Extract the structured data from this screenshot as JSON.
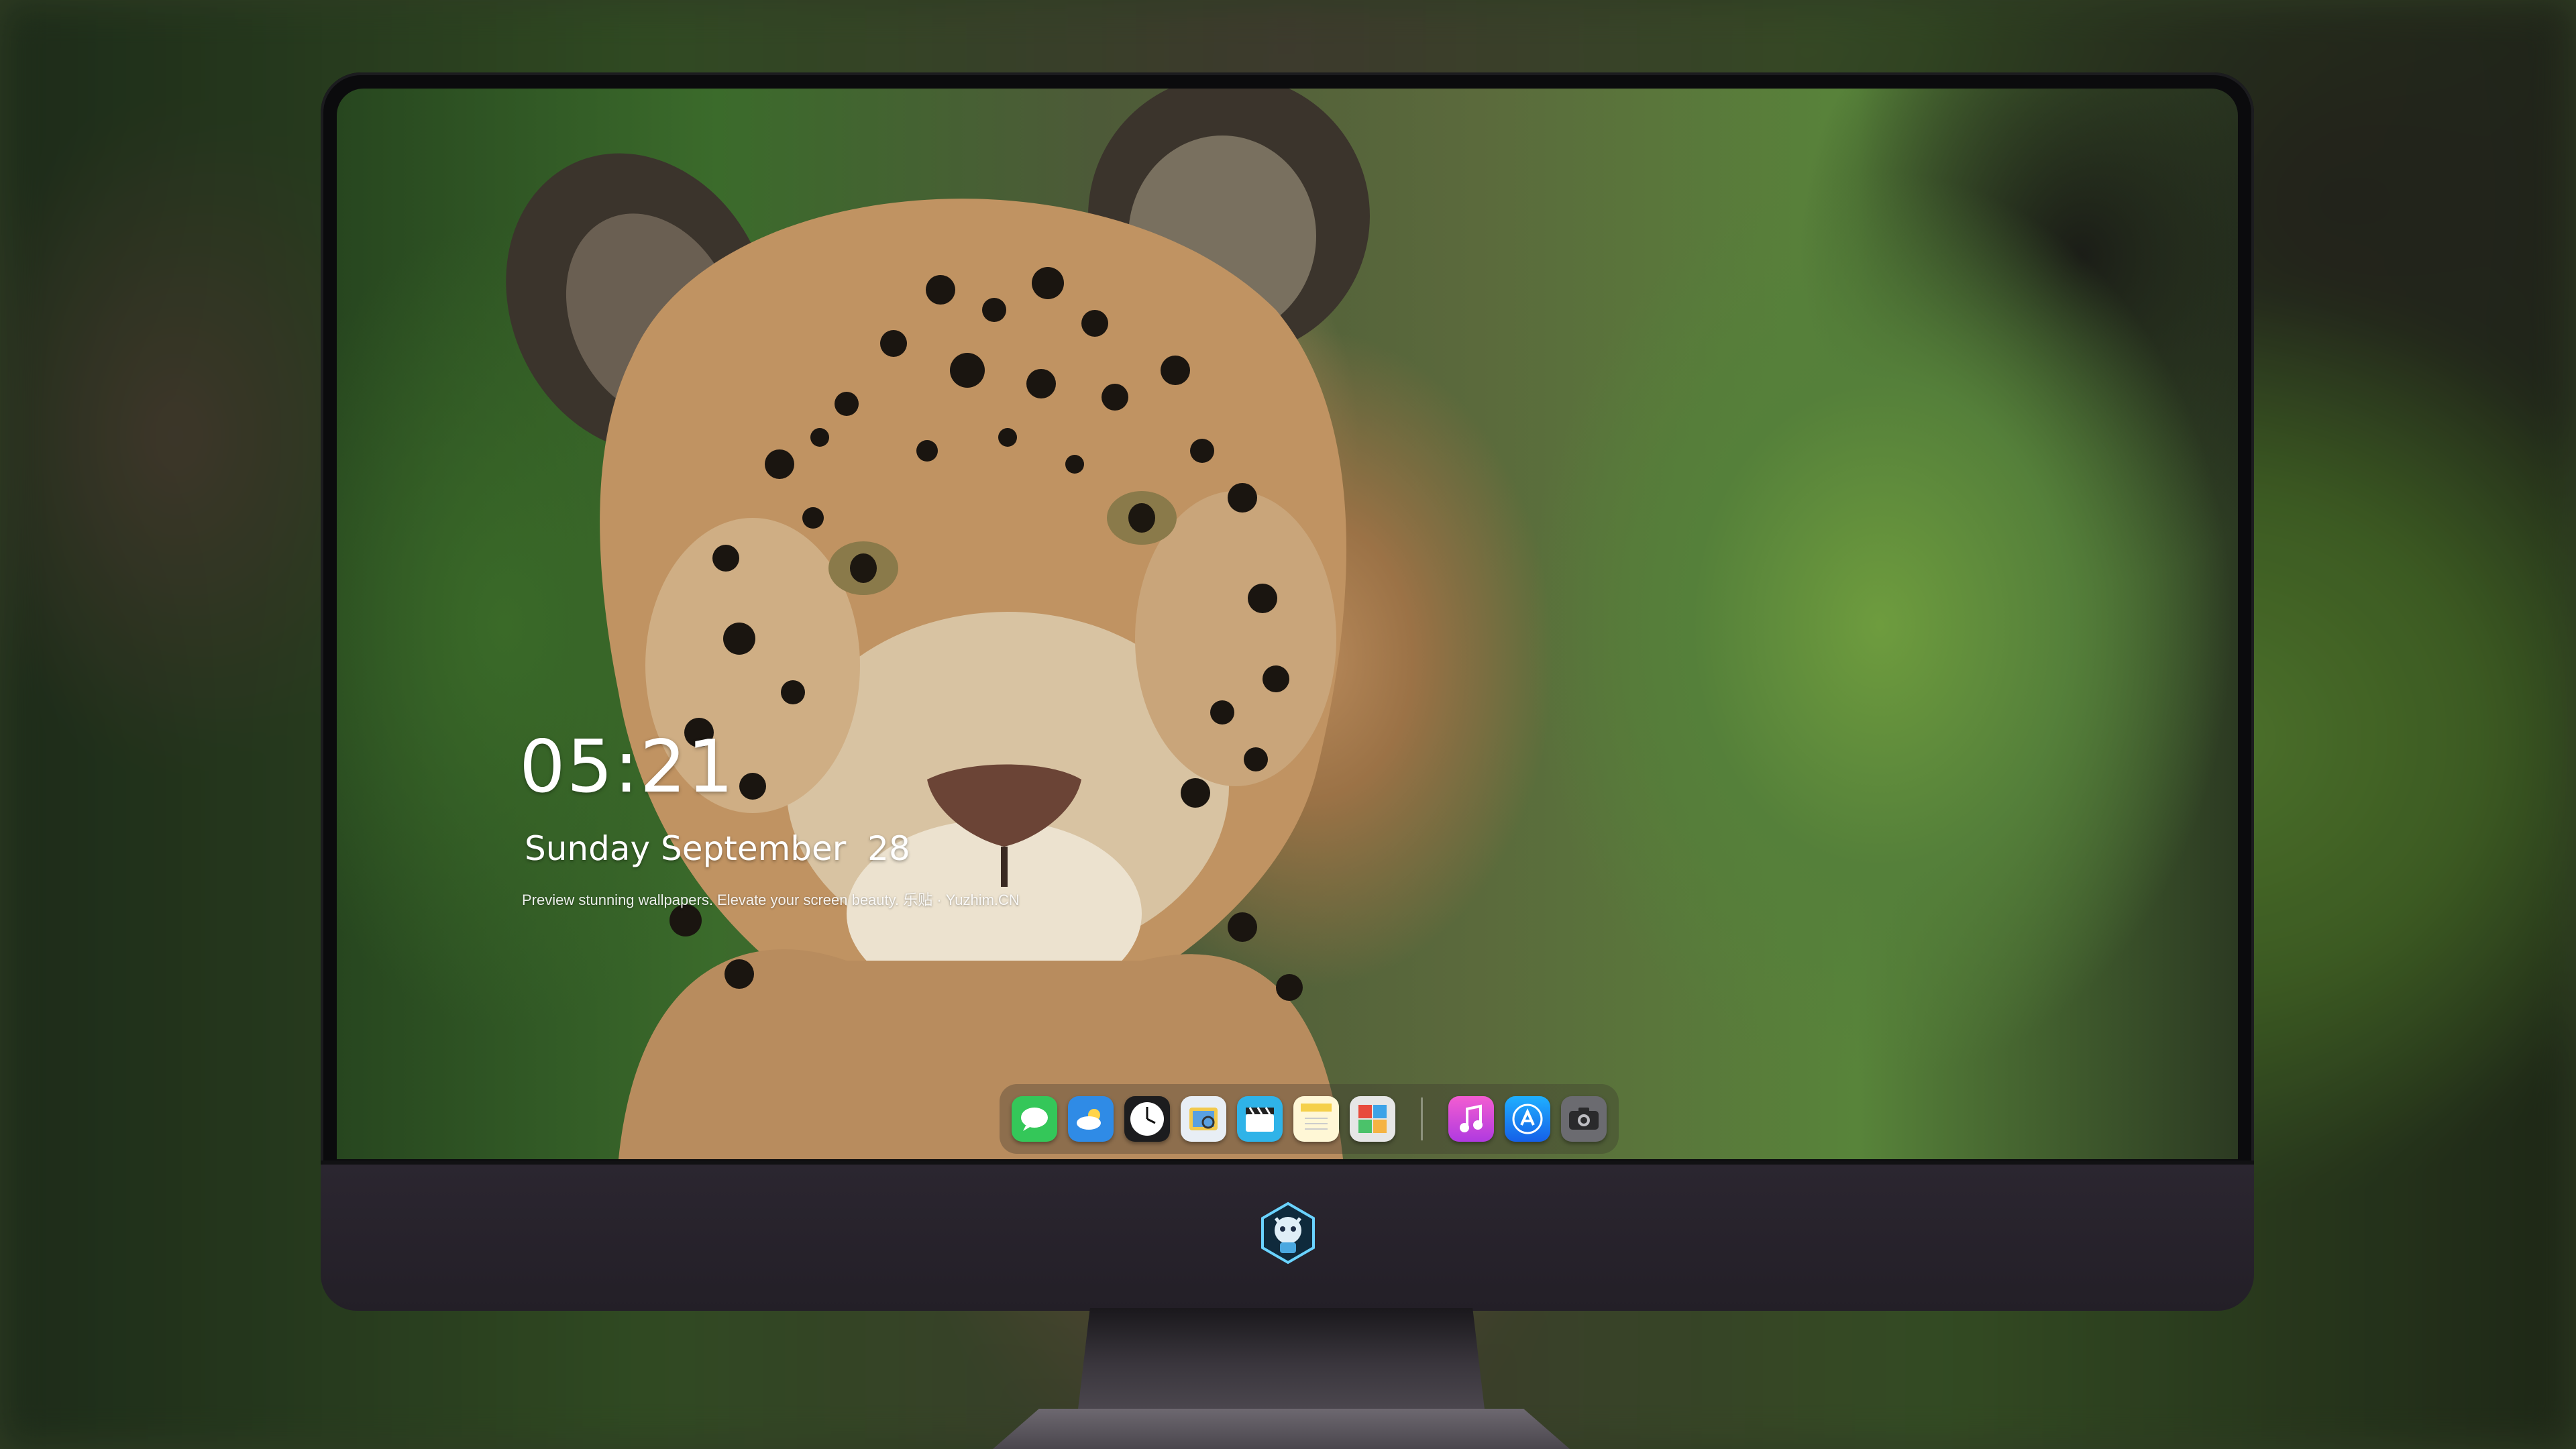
{
  "lock_screen": {
    "time": "05:21",
    "date": "Sunday September  28",
    "tagline": "Preview stunning wallpapers. Elevate your screen beauty. 乐贴 · Yuzhim.CN"
  },
  "dock": {
    "apps": [
      {
        "name": "messages-icon",
        "color": "#34c759"
      },
      {
        "name": "weather-icon",
        "color": "#2f8be6"
      },
      {
        "name": "clock-icon",
        "color": "#1c1c1e"
      },
      {
        "name": "preview-icon",
        "color": "#f2c94c"
      },
      {
        "name": "clips-icon",
        "color": "#2fb3e8"
      },
      {
        "name": "notes-icon",
        "color": "#f5d04a"
      },
      {
        "name": "photo-booth-icon",
        "color": "#e0e0e0"
      },
      {
        "name": "music-icon",
        "color": "#d44bd8"
      },
      {
        "name": "app-store-icon",
        "color": "#1e7cf2"
      },
      {
        "name": "camera-icon",
        "color": "#6b6b70"
      }
    ]
  }
}
